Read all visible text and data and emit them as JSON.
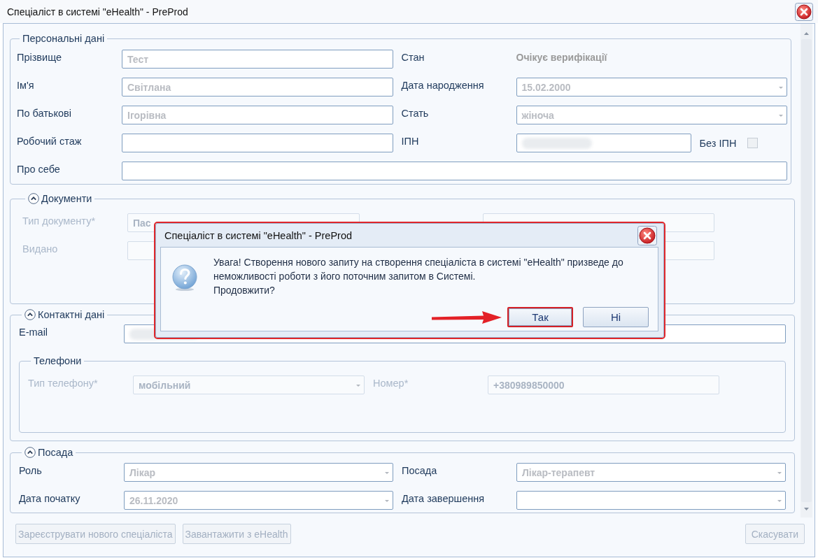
{
  "window": {
    "title": "Спеціаліст в системі \"eHealth\" - PreProd"
  },
  "sections": [
    {
      "title": "Персональні дані",
      "collapsible": false,
      "disabled": false,
      "rows": [
        [
          {
            "label": "Прізвище",
            "field": {
              "kind": "text",
              "value": "Тест"
            }
          },
          {
            "label": "Стан",
            "field": {
              "kind": "status",
              "value": "Очікує верифікації"
            }
          }
        ],
        [
          {
            "label": "Ім'я",
            "field": {
              "kind": "text",
              "value": "Світлана"
            }
          },
          {
            "label": "Дата народження",
            "field": {
              "kind": "dropdown",
              "value": "15.02.2000"
            }
          }
        ],
        [
          {
            "label": "По батькові",
            "field": {
              "kind": "text",
              "value": "Ігорівна"
            }
          },
          {
            "label": "Стать",
            "field": {
              "kind": "dropdown",
              "value": "жіноча"
            }
          }
        ],
        [
          {
            "label": "Робочий стаж",
            "field": {
              "kind": "text"
            }
          },
          {
            "label": "ІПН",
            "field": {
              "kind": "text",
              "redacted": true
            }
          },
          {
            "kind": "checkbox",
            "label": "Без ІПН",
            "checked": false
          }
        ],
        [
          {
            "label": "Про себе",
            "field": {
              "kind": "text"
            }
          }
        ]
      ]
    },
    {
      "title": "Документи",
      "collapsible": true,
      "disabled": true,
      "rows": [
        [
          {
            "label": "Тип документу*",
            "field": {
              "kind": "text",
              "value": "Пас"
            }
          },
          {
            "field": {
              "kind": "text"
            }
          }
        ],
        [
          {
            "label": "Видано",
            "field": {
              "kind": "text"
            }
          },
          {
            "field": {
              "kind": "text"
            }
          }
        ]
      ]
    },
    {
      "title": "Контактні дані",
      "collapsible": true,
      "disabled": false,
      "rows": [
        [
          {
            "label": "E-mail",
            "field": {
              "kind": "text",
              "redacted": true
            }
          }
        ]
      ],
      "subsections": [
        {
          "title": "Телефони",
          "collapsible": false,
          "disabled": true,
          "rows": [
            [
              {
                "label": "Тип телефону*",
                "field": {
                  "kind": "dropdown",
                  "value": "мобільний"
                }
              },
              {
                "label": "Номер*",
                "field": {
                  "kind": "text",
                  "value": "+380989850000"
                }
              }
            ]
          ]
        }
      ]
    },
    {
      "title": "Посада",
      "collapsible": true,
      "disabled": false,
      "rows": [
        [
          {
            "label": "Роль",
            "field": {
              "kind": "dropdown",
              "value": "Лікар"
            }
          },
          {
            "label": "Посада",
            "field": {
              "kind": "dropdown",
              "value": "Лікар-терапевт"
            }
          }
        ],
        [
          {
            "label": "Дата початку",
            "field": {
              "kind": "dropdown",
              "value": "26.11.2020"
            }
          },
          {
            "label": "Дата завершення",
            "field": {
              "kind": "dropdown"
            }
          }
        ]
      ]
    }
  ],
  "footer_buttons": [
    {
      "label": "Зареєструвати нового спеціаліста",
      "disabled": true
    },
    {
      "label": "Завантажити з eHealth",
      "disabled": true
    },
    {
      "label": "Скасувати",
      "disabled": true
    }
  ],
  "dialog": {
    "title": "Спеціаліст в системі \"eHealth\" - PreProd",
    "highlighted": true,
    "message": "Увага! Створення нового запиту на створення спеціаліста в системі \"eHealth\" призведе до неможливості роботи з його поточним запитом в Системі.",
    "question": "Продовжити?",
    "buttons": [
      {
        "label": "Так",
        "highlighted": true
      },
      {
        "label": "Ні",
        "highlighted": false
      }
    ]
  }
}
